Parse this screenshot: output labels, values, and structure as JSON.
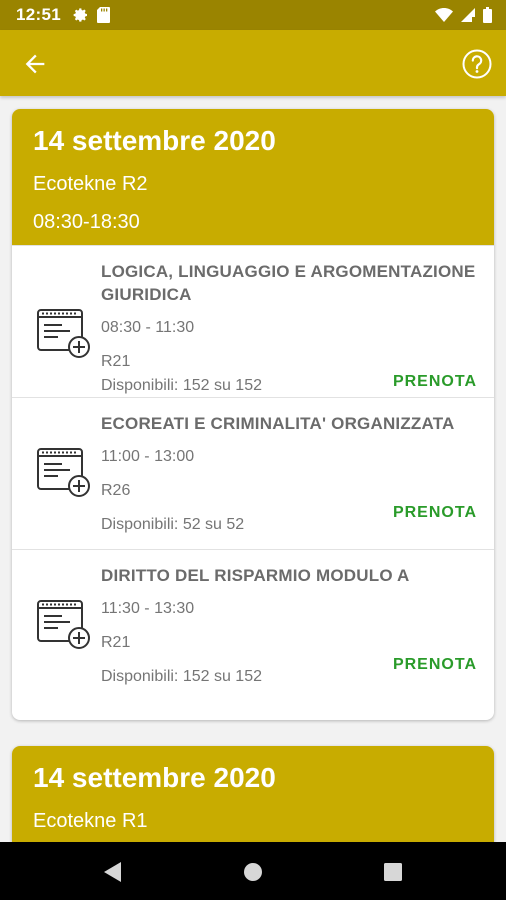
{
  "status_bar": {
    "time": "12:51",
    "icons": [
      "gear-icon",
      "sd-card-icon",
      "wifi-icon",
      "signal-icon",
      "battery-icon"
    ]
  },
  "app_bar": {
    "color": "#c8ac00",
    "back_icon": "arrow-left-icon",
    "help_icon": "help-circle-icon"
  },
  "sessions": [
    {
      "date": "14 settembre 2020",
      "place": "Ecotekne R2",
      "hours": "08:30-18:30",
      "exams": [
        {
          "title": "LOGICA, LINGUAGGIO E ARGOMENTAZIONE GIURIDICA",
          "time": "08:30 - 11:30",
          "room": "R21",
          "availability": "Disponibili: 152 su 152",
          "action": "PRENOTA"
        },
        {
          "title": "ECOREATI E CRIMINALITA' ORGANIZZATA",
          "time": "11:00 - 13:00",
          "room": "R26",
          "availability": "Disponibili: 52 su 52",
          "action": "PRENOTA"
        },
        {
          "title": "DIRITTO DEL RISPARMIO MODULO A",
          "time": "11:30 - 13:30",
          "room": "R21",
          "availability": "Disponibili: 152 su 152",
          "action": "PRENOTA"
        }
      ]
    },
    {
      "date": "14 settembre 2020",
      "place": "Ecotekne R1",
      "hours": "",
      "exams": []
    }
  ],
  "nav_bar": {
    "icons": [
      "back-triangle-icon",
      "home-circle-icon",
      "recents-square-icon"
    ]
  }
}
